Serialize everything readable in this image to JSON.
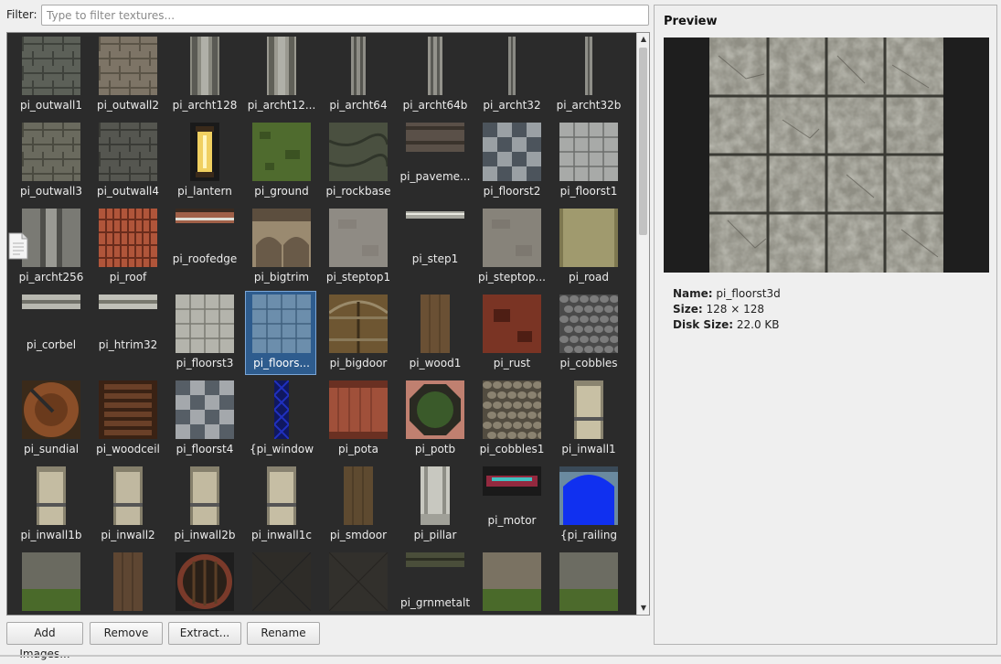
{
  "filter": {
    "label": "Filter:",
    "placeholder": "Type to filter textures...",
    "value": ""
  },
  "textures": [
    {
      "label": "pi_outwall1",
      "kind": "wall",
      "c1": "#5c6058",
      "c2": "#3f423c"
    },
    {
      "label": "pi_outwall2",
      "kind": "wall",
      "c1": "#7d7466",
      "c2": "#5b5447"
    },
    {
      "label": "pi_archt128",
      "kind": "strip",
      "c1": "#8a8a80",
      "c2": "#5a5a54"
    },
    {
      "label": "pi_archt12...",
      "kind": "strip",
      "c1": "#9a9990",
      "c2": "#606058"
    },
    {
      "label": "pi_archt64",
      "kind": "thin",
      "c1": "#8e8d86",
      "c2": "#55554f"
    },
    {
      "label": "pi_archt64b",
      "kind": "thin",
      "c1": "#94938c",
      "c2": "#5a5a55"
    },
    {
      "label": "pi_archt32",
      "kind": "xthin",
      "c1": "#8a8a84",
      "c2": "#555550"
    },
    {
      "label": "pi_archt32b",
      "kind": "xthin",
      "c1": "#8f8f89",
      "c2": "#5a5a55"
    },
    {
      "label": "pi_outwall3",
      "kind": "wall",
      "c1": "#6a6a5e",
      "c2": "#4a4a40"
    },
    {
      "label": "pi_outwall4",
      "kind": "wall",
      "c1": "#555650",
      "c2": "#3a3b36"
    },
    {
      "label": "pi_lantern",
      "kind": "lantern",
      "c1": "#1a1a1a",
      "c2": "#f0d060"
    },
    {
      "label": "pi_ground",
      "kind": "grass",
      "c1": "#4f6b2e",
      "c2": "#3b5222"
    },
    {
      "label": "pi_rockbase",
      "kind": "rock",
      "c1": "#4a5040",
      "c2": "#30352a"
    },
    {
      "label": "pi_paveme...",
      "kind": "pave",
      "c1": "#5a5048",
      "c2": "#3a332c"
    },
    {
      "label": "pi_floorst2",
      "kind": "check",
      "c1": "#9aa0a4",
      "c2": "#4c545c"
    },
    {
      "label": "pi_floorst1",
      "kind": "tiles",
      "c1": "#a8aaa8",
      "c2": "#6c6e6c"
    },
    {
      "label": "pi_archt256",
      "kind": "strip2",
      "c1": "#7a7a74",
      "c2": "#4e4e4a"
    },
    {
      "label": "pi_roof",
      "kind": "roof",
      "c1": "#b0553a",
      "c2": "#6a2c1c"
    },
    {
      "label": "pi_roofedge",
      "kind": "edge",
      "c1": "#a06048",
      "c2": "#e0e0d8"
    },
    {
      "label": "pi_bigtrim",
      "kind": "trim",
      "c1": "#9a8a70",
      "c2": "#5c4e3e"
    },
    {
      "label": "pi_steptop1",
      "kind": "flat",
      "c1": "#8f8b84",
      "c2": "#77736c"
    },
    {
      "label": "pi_step1",
      "kind": "edge2",
      "c1": "#a8a8a0",
      "c2": "#e8e8e0"
    },
    {
      "label": "pi_steptop...",
      "kind": "flat",
      "c1": "#87837a",
      "c2": "#6e6a62"
    },
    {
      "label": "pi_road",
      "kind": "road",
      "c1": "#a09a6e",
      "c2": "#7e7850"
    },
    {
      "label": "pi_corbel",
      "kind": "bar",
      "c1": "#b8b8b0",
      "c2": "#707068"
    },
    {
      "label": "pi_htrim32",
      "kind": "bar",
      "c1": "#c0c0b8",
      "c2": "#78786e"
    },
    {
      "label": "pi_floorst3",
      "kind": "tiles",
      "c1": "#b4b4ac",
      "c2": "#7a7a72"
    },
    {
      "label": "pi_floors...",
      "kind": "bluetiles",
      "c1": "#6c8eac",
      "c2": "#40607e",
      "selected": true
    },
    {
      "label": "pi_bigdoor",
      "kind": "door",
      "c1": "#6e5632",
      "c2": "#3c2e1a"
    },
    {
      "label": "pi_wood1",
      "kind": "wood",
      "c1": "#6a5034",
      "c2": "#4a3620"
    },
    {
      "label": "pi_rust",
      "kind": "rust",
      "c1": "#7a3424",
      "c2": "#4e1e14"
    },
    {
      "label": "pi_cobbles",
      "kind": "cobble",
      "c1": "#7c7c7c",
      "c2": "#4a4a4a"
    },
    {
      "label": "pi_sundial",
      "kind": "sundial",
      "c1": "#8a4e28",
      "c2": "#3a2a1a"
    },
    {
      "label": "pi_woodceil",
      "kind": "ceil",
      "c1": "#6a4028",
      "c2": "#3a2214"
    },
    {
      "label": "pi_floorst4",
      "kind": "check",
      "c1": "#a4a8ac",
      "c2": "#565e66"
    },
    {
      "label": "{pi_window",
      "kind": "window",
      "c1": "#2030c0",
      "c2": "#101860"
    },
    {
      "label": "pi_pota",
      "kind": "pota",
      "c1": "#a0503a",
      "c2": "#6a3022"
    },
    {
      "label": "pi_potb",
      "kind": "potb",
      "c1": "#c08070",
      "c2": "#3a5a2a"
    },
    {
      "label": "pi_cobbles1",
      "kind": "cobble",
      "c1": "#8a8270",
      "c2": "#524c40"
    },
    {
      "label": "pi_inwall1",
      "kind": "inwall",
      "c1": "#c8c0a4",
      "c2": "#8a8470"
    },
    {
      "label": "pi_inwall1b",
      "kind": "inwall",
      "c1": "#c4bca2",
      "c2": "#8a8470"
    },
    {
      "label": "pi_inwall2",
      "kind": "inwall",
      "c1": "#c0b8a0",
      "c2": "#847e6a"
    },
    {
      "label": "pi_inwall2b",
      "kind": "inwall",
      "c1": "#c2baa0",
      "c2": "#86806c"
    },
    {
      "label": "pi_inwall1c",
      "kind": "inwall",
      "c1": "#c6bea4",
      "c2": "#888270"
    },
    {
      "label": "pi_smdoor",
      "kind": "wood",
      "c1": "#5e4a30",
      "c2": "#3e301e"
    },
    {
      "label": "pi_pillar",
      "kind": "pillar",
      "c1": "#c8c8c0",
      "c2": "#8e8e86"
    },
    {
      "label": "pi_motor",
      "kind": "motor",
      "c1": "#1a1a1a",
      "c2": "#c83050"
    },
    {
      "label": "{pi_railing",
      "kind": "railing",
      "c1": "#1030f0",
      "c2": "#6a8aa0"
    },
    {
      "label": "",
      "kind": "wallgrass",
      "c1": "#6a6a60",
      "c2": "#4a6a2a"
    },
    {
      "label": "",
      "kind": "wood",
      "c1": "#5e4632",
      "c2": "#3a2c1e"
    },
    {
      "label": "",
      "kind": "round",
      "c1": "#5a3e26",
      "c2": "#2a2018"
    },
    {
      "label": "",
      "kind": "dark",
      "c1": "#2e2c28",
      "c2": "#222"
    },
    {
      "label": "",
      "kind": "dark",
      "c1": "#32302c",
      "c2": "#262420"
    },
    {
      "label": "pi_grnmetalt",
      "kind": "edge3",
      "c1": "#4a4e3a",
      "c2": "#2c2e22"
    },
    {
      "label": "",
      "kind": "wallgrass",
      "c1": "#7a7262",
      "c2": "#4a6a2a"
    },
    {
      "label": "",
      "kind": "wallgrass",
      "c1": "#6c6c62",
      "c2": "#4c6a2c"
    }
  ],
  "buttons": {
    "add": "Add Images...",
    "remove": "Remove",
    "extract": "Extract...",
    "rename": "Rename"
  },
  "preview": {
    "title": "Preview",
    "name_key": "Name:",
    "name_value": "pi_floorst3d",
    "size_key": "Size:",
    "size_value": "128 × 128",
    "disk_key": "Disk Size:",
    "disk_value": "22.0 KB"
  }
}
